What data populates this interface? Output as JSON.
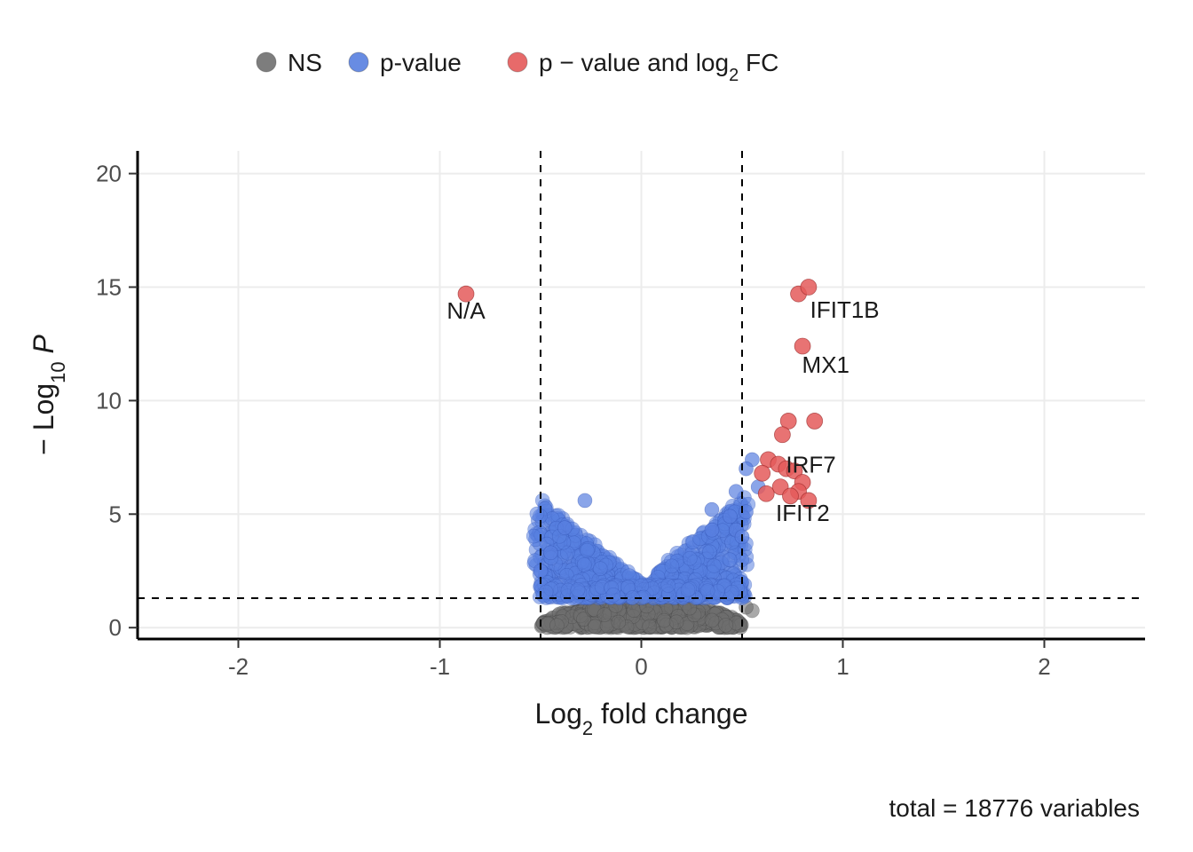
{
  "chart_data": {
    "type": "scatter",
    "title": "",
    "xlabel_prefix": "Log",
    "xlabel_sub": "2",
    "xlabel_rest": " fold change",
    "ylabel_prefix": "− Log",
    "ylabel_sub": "10",
    "ylabel_rest": " ",
    "ylabel_ital": "P",
    "xlim": [
      -2.5,
      2.5
    ],
    "ylim": [
      -0.5,
      21
    ],
    "xticks": [
      -2,
      -1,
      0,
      1,
      2
    ],
    "yticks": [
      0,
      5,
      10,
      15,
      20
    ],
    "thresholds": {
      "x_neg": -0.5,
      "x_pos": 0.5,
      "y": 1.3
    },
    "footer": "total = 18776 variables",
    "legend": [
      {
        "label": "NS",
        "color": "#6f6f6f"
      },
      {
        "label": "p-value",
        "color": "#587fe0"
      },
      {
        "label": "p − value and log",
        "sub": "2",
        "rest": " FC",
        "color": "#e45a5a"
      }
    ],
    "annotations": [
      {
        "label": "N/A",
        "x": -0.87,
        "y": 14.7,
        "align": "mid",
        "dy": 28
      },
      {
        "label": "IFIT1B",
        "x": 0.82,
        "y": 14.9,
        "align": "start",
        "dy": 32
      },
      {
        "label": "MX1",
        "x": 0.78,
        "y": 12.4,
        "align": "start",
        "dy": 30
      },
      {
        "label": "IRF7",
        "x": 0.7,
        "y": 8.0,
        "align": "start",
        "dy": 30
      },
      {
        "label": "IFIT2",
        "x": 0.65,
        "y": 5.8,
        "align": "start",
        "dy": 28
      }
    ],
    "colors": {
      "ns": "#6f6f6f",
      "p": "#587fe0",
      "sig": "#e45a5a"
    },
    "series_red": [
      {
        "x": -0.87,
        "y": 14.7
      },
      {
        "x": 0.78,
        "y": 14.7
      },
      {
        "x": 0.83,
        "y": 15.0
      },
      {
        "x": 0.8,
        "y": 12.4
      },
      {
        "x": 0.73,
        "y": 9.1
      },
      {
        "x": 0.86,
        "y": 9.1
      },
      {
        "x": 0.7,
        "y": 8.5
      },
      {
        "x": 0.63,
        "y": 7.4
      },
      {
        "x": 0.68,
        "y": 7.2
      },
      {
        "x": 0.72,
        "y": 7.0
      },
      {
        "x": 0.76,
        "y": 6.9
      },
      {
        "x": 0.6,
        "y": 6.8
      },
      {
        "x": 0.8,
        "y": 6.4
      },
      {
        "x": 0.69,
        "y": 6.2
      },
      {
        "x": 0.78,
        "y": 6.0
      },
      {
        "x": 0.74,
        "y": 5.8
      },
      {
        "x": 0.62,
        "y": 5.9
      },
      {
        "x": 0.83,
        "y": 5.6
      }
    ],
    "blue_cloud": {
      "n": 650,
      "x_center": 0.0,
      "x_spread_max": 0.52,
      "y_base": 1.3,
      "y_peak": 5.5,
      "tail_pts": [
        {
          "x": -0.28,
          "y": 5.6
        },
        {
          "x": 0.35,
          "y": 5.2
        },
        {
          "x": 0.35,
          "y": 4.3
        },
        {
          "x": 0.47,
          "y": 4.3
        },
        {
          "x": 0.44,
          "y": 4.9
        },
        {
          "x": 0.47,
          "y": 6.0
        },
        {
          "x": 0.55,
          "y": 7.4
        },
        {
          "x": 0.52,
          "y": 7.0
        },
        {
          "x": 0.58,
          "y": 6.2
        },
        {
          "x": 0.5,
          "y": 4.0
        },
        {
          "x": 0.52,
          "y": 5.1
        },
        {
          "x": -0.38,
          "y": 4.4
        },
        {
          "x": -0.45,
          "y": 3.3
        },
        {
          "x": -0.5,
          "y": 2.5
        }
      ]
    },
    "grey_cloud": {
      "n": 900,
      "x_spread": 0.5,
      "y_top": 1.3,
      "extra": [
        {
          "x": 0.55,
          "y": 0.75
        },
        {
          "x": 0.52,
          "y": 0.9
        }
      ]
    }
  }
}
